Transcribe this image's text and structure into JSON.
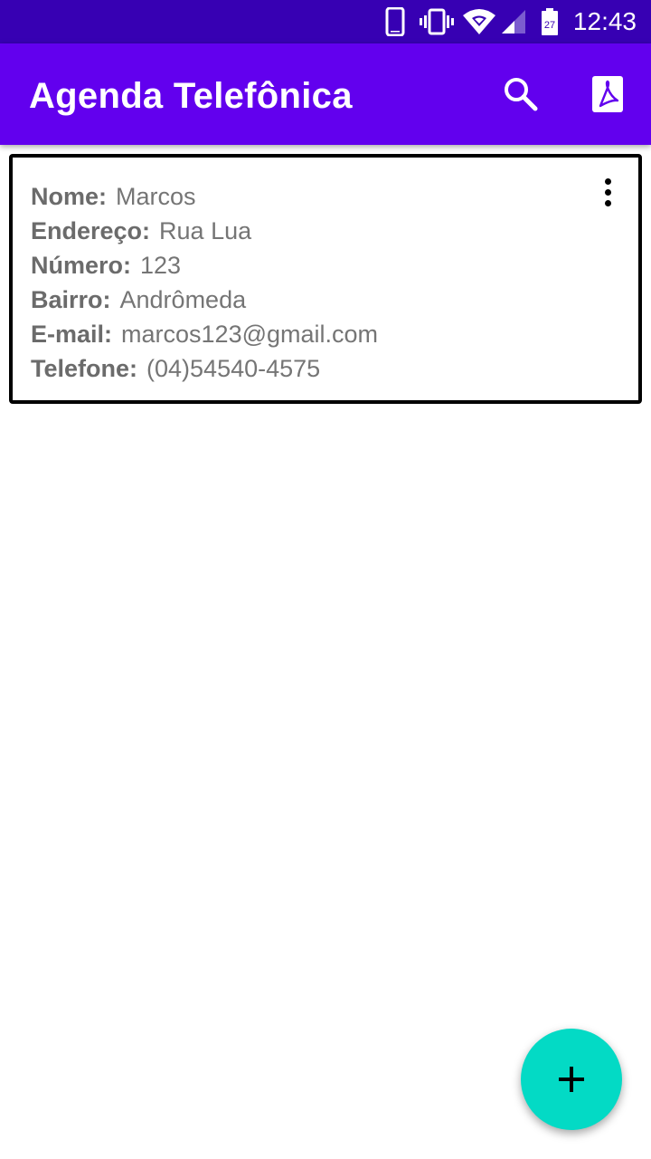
{
  "status_bar": {
    "time": "12:43",
    "battery_level": "27",
    "icons": [
      "phone-icon",
      "vibrate-icon",
      "wifi-icon",
      "signal-icon",
      "battery-icon"
    ]
  },
  "app_bar": {
    "title": "Agenda Telefônica",
    "actions": [
      "search-icon",
      "pdf-icon"
    ],
    "color": "#6200ee"
  },
  "contacts": [
    {
      "fields": [
        {
          "label": "Nome:",
          "value": "Marcos"
        },
        {
          "label": "Endereço:",
          "value": "Rua Lua"
        },
        {
          "label": "Número:",
          "value": "123"
        },
        {
          "label": "Bairro:",
          "value": "Andrômeda"
        },
        {
          "label": "E-mail:",
          "value": "marcos123@gmail.com"
        },
        {
          "label": "Telefone:",
          "value": "(04)54540-4575"
        }
      ],
      "menu_icon": "more-vert-icon"
    }
  ],
  "fab": {
    "icon": "plus-icon",
    "color": "#03dac5"
  }
}
